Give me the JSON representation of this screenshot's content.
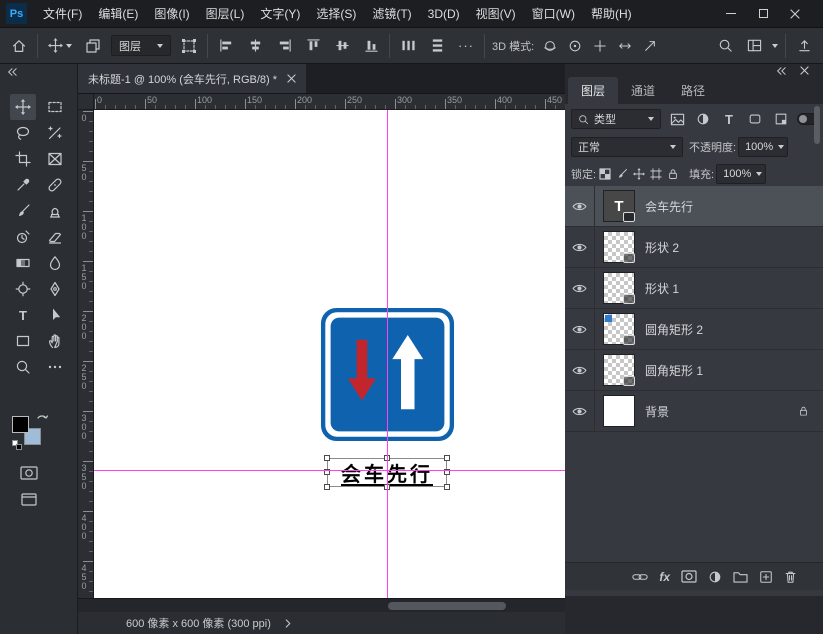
{
  "titlebar": {
    "logo": "Ps",
    "menus": [
      "文件(F)",
      "编辑(E)",
      "图像(I)",
      "图层(L)",
      "文字(Y)",
      "选择(S)",
      "滤镜(T)",
      "3D(D)",
      "视图(V)",
      "窗口(W)",
      "帮助(H)"
    ]
  },
  "options": {
    "target": "图层",
    "more": "···",
    "mode_label": "3D 模式:"
  },
  "doc": {
    "tab": "未标题-1 @ 100% (会车先行, RGB/8) *",
    "status": "600 像素 x 600 像素 (300 ppi)",
    "text": "会车先行",
    "ruler_h": [
      "0",
      "50",
      "100",
      "150",
      "200",
      "250",
      "300",
      "350",
      "400",
      "450"
    ],
    "ruler_v": [
      "0",
      "50",
      "100",
      "150",
      "200",
      "250",
      "300",
      "350",
      "400",
      "450"
    ]
  },
  "panel": {
    "tabs": [
      "图层",
      "通道",
      "路径"
    ],
    "kind": "类型",
    "blend": "正常",
    "opacity_label": "不透明度:",
    "opacity": "100%",
    "lock_label": "锁定:",
    "fill_label": "填充:",
    "fill": "100%",
    "layers": [
      {
        "name": "会车先行",
        "type": "text",
        "selected": true
      },
      {
        "name": "形状 2",
        "type": "shape"
      },
      {
        "name": "形状 1",
        "type": "shape"
      },
      {
        "name": "圆角矩形 2",
        "type": "shape"
      },
      {
        "name": "圆角矩形 1",
        "type": "shape"
      },
      {
        "name": "背景",
        "type": "background",
        "locked": true
      }
    ]
  },
  "icons": {
    "type_glyph": "T",
    "fx_glyph": "fx"
  },
  "colors": {
    "sign_blue": "#0f63ae",
    "arrow_red": "#c2262c",
    "guide": "#ff40f0",
    "foreground": "#000000",
    "background_swatch": "#9fbcd8"
  }
}
